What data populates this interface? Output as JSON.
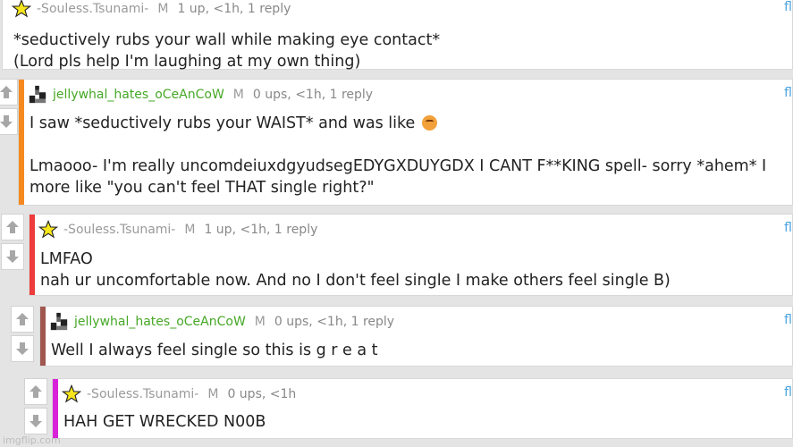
{
  "comments": [
    {
      "author": "-Souless.Tsunami-",
      "mod_badge": "M",
      "stats": "1 up, <1h, 1 reply",
      "flag_link": "fl",
      "lines": [
        "*seductively rubs your wall while making eye contact*",
        "(Lord pls help I'm laughing at my own thing)"
      ]
    },
    {
      "author": "jellywhal_hates_oCeAnCoW",
      "mod_badge": "M",
      "stats": "0 ups, <1h, 1 reply",
      "flag_link": "fl",
      "accent": "#f5891f",
      "lines": [
        "I saw *seductively rubs your WAIST* and was like",
        "",
        "Lmaooo- I'm really uncomdeiuxdgyudsegEDYGXDUYGDX I CANT F**KING spell- sorry *ahem* I",
        "more like \"you can't feel THAT single right?\""
      ]
    },
    {
      "author": "-Souless.Tsunami-",
      "mod_badge": "M",
      "stats": "1 up, <1h, 1 reply",
      "flag_link": "fl",
      "accent": "#ee3b3b",
      "lines": [
        "LMFAO",
        "nah ur uncomfortable now. And no I don't feel single I make others feel single B)"
      ]
    },
    {
      "author": "jellywhal_hates_oCeAnCoW",
      "mod_badge": "M",
      "stats": "0 ups, <1h, 1 reply",
      "flag_link": "fl",
      "accent": "#a0574f",
      "lines": [
        "Well I always feel single so this is g r e a t"
      ]
    },
    {
      "author": "-Souless.Tsunami-",
      "mod_badge": "M",
      "stats": "0 ups, <1h",
      "flag_link": "fl",
      "accent": "#d822d8",
      "lines": [
        "HAH GET WRECKED N00B"
      ]
    }
  ],
  "icons": {
    "upvote": "up-arrow-icon",
    "downvote": "down-arrow-icon",
    "star_avatar": "star-icon",
    "pixel_avatar": "pixel-avatar-icon",
    "emoji": "pleading-face-emoji"
  },
  "colors": {
    "username_green": "#46a826",
    "flag_blue": "#4aa3df",
    "vote_arrow": "#a7a7a7"
  },
  "watermark": "imgflip.com"
}
